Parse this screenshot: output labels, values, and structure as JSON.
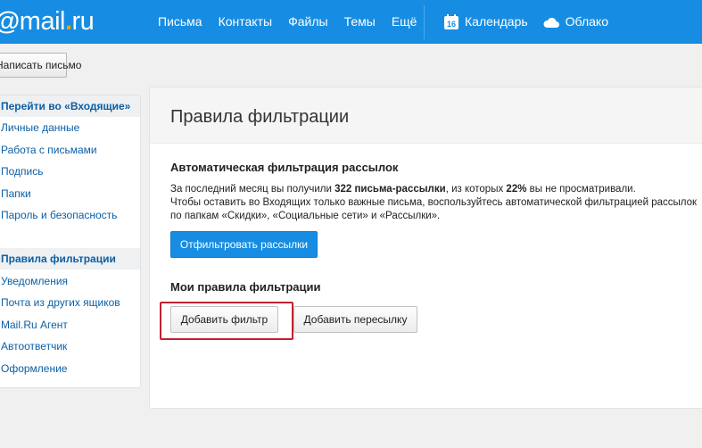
{
  "header": {
    "logo": {
      "at": "@",
      "name": "mail",
      "dot": ".",
      "tld": "ru"
    },
    "nav": [
      "Письма",
      "Контакты",
      "Файлы",
      "Темы",
      "Ещё"
    ],
    "services": [
      {
        "label": "Календарь",
        "icon": "calendar-icon",
        "badge": "16"
      },
      {
        "label": "Облако",
        "icon": "cloud-icon"
      }
    ],
    "colors": {
      "bar": "#168de2",
      "accent": "#f7a100"
    }
  },
  "compose": {
    "label": "Написать письмо"
  },
  "sidebar": {
    "items": [
      {
        "label": "Перейти во «Входящие»",
        "active": true
      },
      {
        "label": "Личные данные"
      },
      {
        "label": "Работа с письмами"
      },
      {
        "label": "Подпись"
      },
      {
        "label": "Папки"
      },
      {
        "label": "Пароль и безопасность"
      },
      {
        "label": "Правила фильтрации",
        "active": true
      },
      {
        "label": "Уведомления"
      },
      {
        "label": "Почта из других ящиков"
      },
      {
        "label": "Mail.Ru Агент"
      },
      {
        "label": "Автоответчик"
      },
      {
        "label": "Оформление"
      }
    ]
  },
  "main": {
    "title": "Правила фильтрации",
    "auto": {
      "title": "Автоматическая фильтрация рассылок",
      "line1_a": "За последний месяц вы получили ",
      "line1_count": "322 письма-рассылки",
      "line1_b": ", из которых ",
      "line1_pct": "22%",
      "line1_c": " вы не просматривали.",
      "line2": "Чтобы оставить во Входящих только важные письма, воспользуйтесь автоматической фильтрацией рассылок",
      "line3": "по папкам «Скидки», «Социальные сети» и «Рассылки».",
      "button": "Отфильтровать рассылки"
    },
    "rules": {
      "title": "Мои правила фильтрации",
      "add_filter": "Добавить фильтр",
      "add_forward": "Добавить пересылку"
    },
    "colors": {
      "button": "#168de2",
      "highlight": "#c0222f"
    }
  }
}
